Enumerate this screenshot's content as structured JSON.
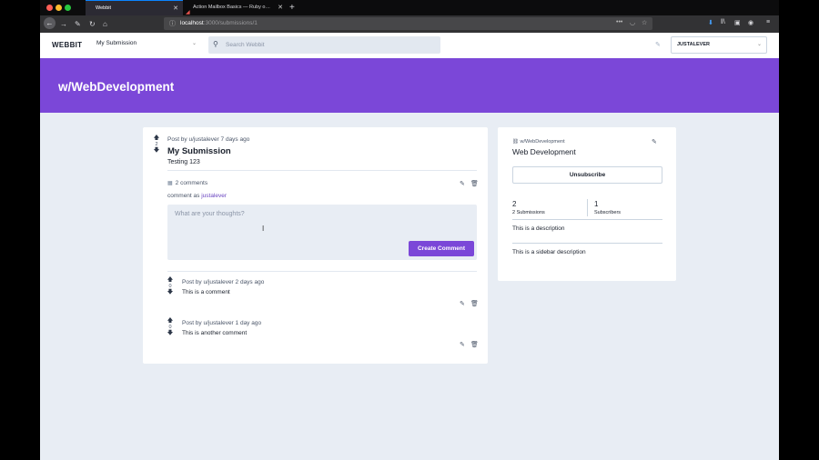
{
  "browser": {
    "tabs": [
      {
        "label": "Webbit",
        "active": true
      },
      {
        "label": "Action Mailbox Basics — Ruby on Rails",
        "active": false
      }
    ],
    "new_tab_icon": "+",
    "url_host": "localhost",
    "url_path": ":3000/submissions/1"
  },
  "app": {
    "brand": "WEBBIT",
    "community_select": "My Submission",
    "search_placeholder": "Search Webbit",
    "user_select": "JUSTALEVER"
  },
  "banner": {
    "title": "w/WebDevelopment"
  },
  "post": {
    "votes": "2",
    "meta": "Post by u/justalever 7 days ago",
    "title": "My Submission",
    "body": "Testing 123",
    "comments_count": "2 comments",
    "comment_as_prefix": "comment as",
    "comment_as_user": "justalever",
    "comment_placeholder": "What are your thoughts?",
    "create_button": "Create Comment"
  },
  "comments": [
    {
      "votes": "0",
      "meta": "Post by u/justalever 2 days ago",
      "body": "This is a comment"
    },
    {
      "votes": "0",
      "meta": "Post by u/justalever 1 day ago",
      "body": "This is another comment"
    }
  ],
  "sidebar": {
    "tag": "w/WebDevelopment",
    "title": "Web Development",
    "unsubscribe": "Unsubscribe",
    "submissions_num": "2",
    "submissions_label": "2 Submissions",
    "subscribers_num": "1",
    "subscribers_label": "Subscribers",
    "description": "This is a description",
    "sidebar_description": "This is a sidebar description"
  },
  "colors": {
    "accent": "#7b47d8",
    "page_bg": "#e8edf4"
  }
}
